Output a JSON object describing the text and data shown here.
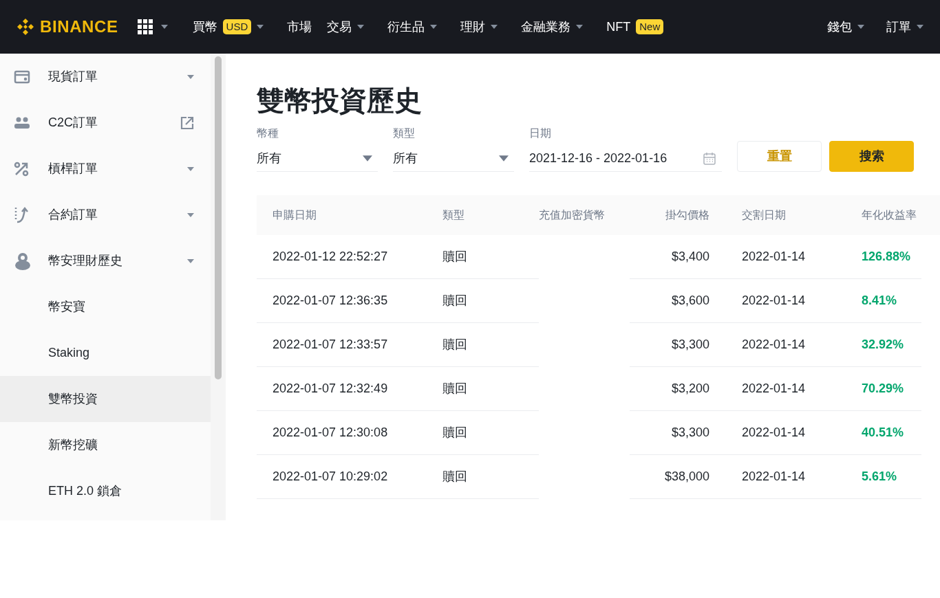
{
  "header": {
    "logo": "BINANCE",
    "nav": [
      {
        "label": "買幣",
        "badge": "USD",
        "caret": true
      },
      {
        "label": "市場",
        "caret": false
      },
      {
        "label": "交易",
        "caret": true
      },
      {
        "label": "衍生品",
        "caret": true
      },
      {
        "label": "理財",
        "caret": true
      },
      {
        "label": "金融業務",
        "caret": true
      },
      {
        "label": "NFT",
        "badge": "New",
        "caret": false
      }
    ],
    "right_nav": [
      {
        "label": "錢包",
        "caret": true
      },
      {
        "label": "訂單",
        "caret": true
      }
    ]
  },
  "sidebar": {
    "items": [
      {
        "label": "現貨訂單",
        "kind": "dropdown",
        "selected": false
      },
      {
        "label": "C2C訂單",
        "kind": "external",
        "selected": false
      },
      {
        "label": "槓桿訂單",
        "kind": "dropdown",
        "selected": false
      },
      {
        "label": "合約訂單",
        "kind": "dropdown",
        "selected": false
      },
      {
        "label": "幣安理財歷史",
        "kind": "dropdown",
        "selected": false
      },
      {
        "label": "幣安寶",
        "kind": "child",
        "selected": false
      },
      {
        "label": "Staking",
        "kind": "child",
        "selected": false
      },
      {
        "label": "雙幣投資",
        "kind": "child",
        "selected": true
      },
      {
        "label": "新幣挖礦",
        "kind": "child",
        "selected": false
      },
      {
        "label": "ETH 2.0 鎖倉",
        "kind": "child",
        "selected": false
      }
    ]
  },
  "page": {
    "title": "雙幣投資歷史",
    "filters": [
      {
        "label": "幣種",
        "value": "所有",
        "kind": "select"
      },
      {
        "label": "類型",
        "value": "所有",
        "kind": "select"
      },
      {
        "label": "日期",
        "value": "2021-12-16 - 2022-01-16",
        "kind": "date"
      }
    ],
    "buttons": [
      {
        "label": "重置",
        "kind": "secondary"
      },
      {
        "label": "搜索",
        "kind": "primary"
      }
    ],
    "table": {
      "columns": [
        "申購日期",
        "類型",
        "充值加密貨幣",
        "掛勾價格",
        "交割日期",
        "年化收益率"
      ],
      "rows": [
        [
          "2022-01-12 22:52:27",
          "贖回",
          "",
          "$3,400",
          "2022-01-14",
          "126.88%"
        ],
        [
          "2022-01-07 12:36:35",
          "贖回",
          "",
          "$3,600",
          "2022-01-14",
          "8.41%"
        ],
        [
          "2022-01-07 12:33:57",
          "贖回",
          "",
          "$3,300",
          "2022-01-14",
          "32.92%"
        ],
        [
          "2022-01-07 12:32:49",
          "贖回",
          "",
          "$3,200",
          "2022-01-14",
          "70.29%"
        ],
        [
          "2022-01-07 12:30:08",
          "贖回",
          "",
          "$3,300",
          "2022-01-14",
          "40.51%"
        ],
        [
          "2022-01-07 10:29:02",
          "贖回",
          "",
          "$38,000",
          "2022-01-14",
          "5.61%"
        ]
      ]
    }
  }
}
